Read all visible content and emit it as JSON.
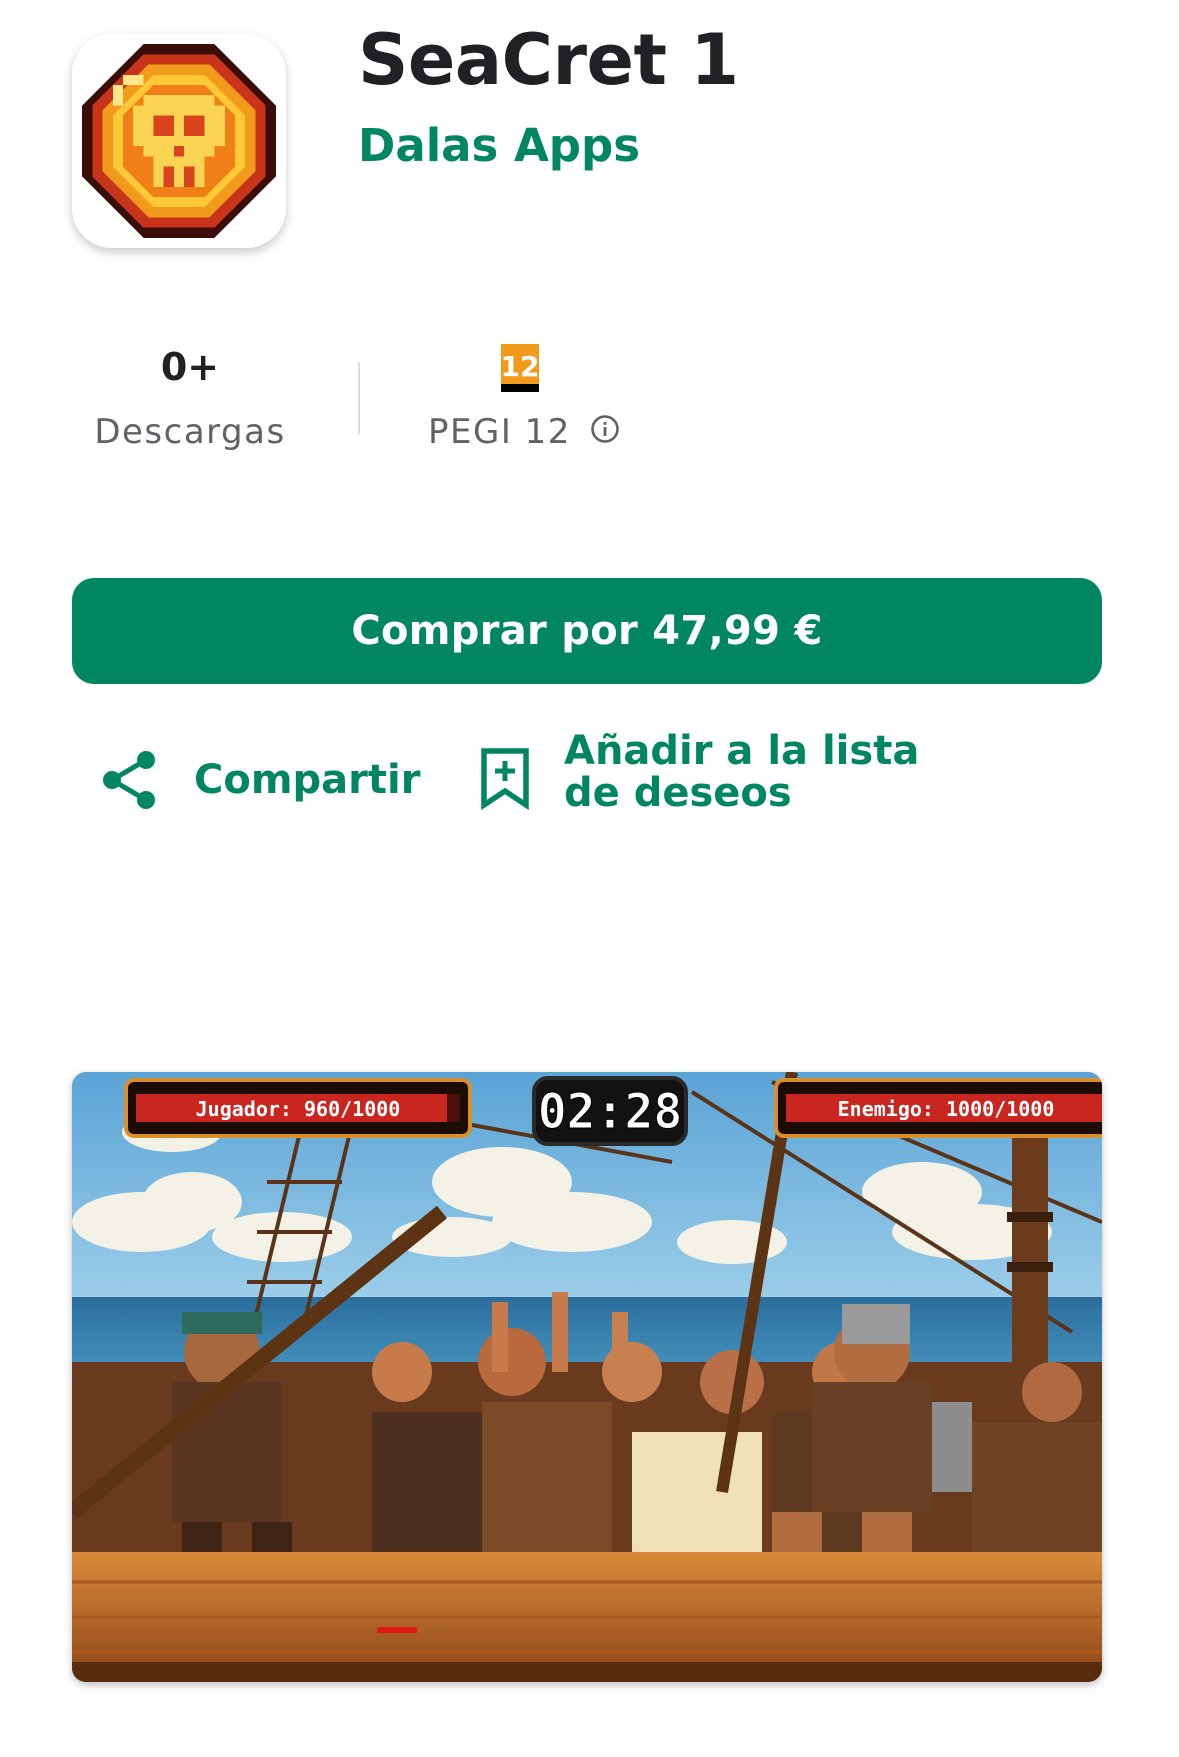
{
  "app": {
    "title": "SeaCret 1",
    "developer": "Dalas Apps",
    "icon": "pixel-skull-coin-icon"
  },
  "stats": {
    "downloads": {
      "value": "0+",
      "label": "Descargas"
    },
    "rating": {
      "badge_text": "12",
      "label": "PEGI 12",
      "info_icon": "info-icon"
    }
  },
  "buy_button": {
    "label": "Comprar por 47,99 €"
  },
  "actions": {
    "share": {
      "label": "Compartir",
      "icon": "share-icon"
    },
    "wishlist": {
      "label": "Añadir a la lista de deseos",
      "icon": "bookmark-add-icon"
    }
  },
  "screenshot": {
    "hud_player": "Jugador: 960/1000",
    "hud_timer": "02:28",
    "hud_enemy": "Enemigo: 1000/1000",
    "player_health": 0.96,
    "enemy_health": 1.0
  },
  "colors": {
    "accent": "#01875f",
    "text_primary": "#202124",
    "text_secondary": "#5f6368"
  }
}
